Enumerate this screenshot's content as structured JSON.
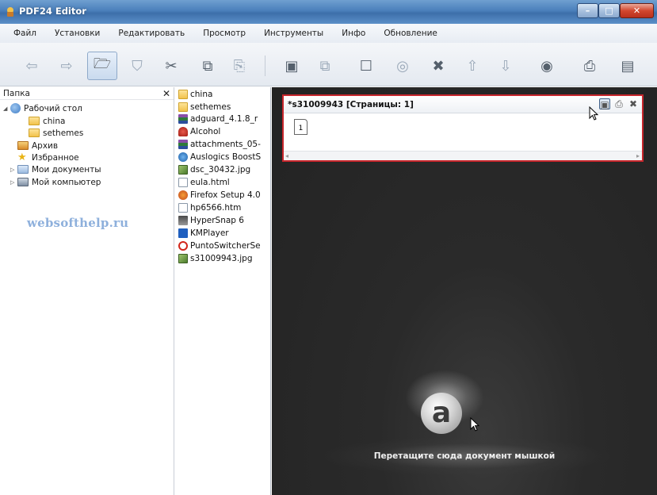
{
  "window": {
    "title": "PDF24 Editor",
    "minimize": "–",
    "maximize": "□",
    "close": "✕"
  },
  "menu": [
    "Файл",
    "Установки",
    "Редактировать",
    "Просмотр",
    "Инструменты",
    "Инфо",
    "Обновление"
  ],
  "toolbar": {
    "buttons": [
      {
        "name": "back-arrow-icon",
        "glyph": "⇦"
      },
      {
        "name": "forward-arrow-icon",
        "glyph": "⇨"
      },
      {
        "name": "open-folder-icon",
        "glyph": "🗁"
      },
      {
        "name": "shield-icon",
        "glyph": "⛉"
      },
      {
        "name": "scissors-icon",
        "glyph": "✂"
      },
      {
        "name": "copy-icon",
        "glyph": "⧉"
      },
      {
        "name": "paste-icon",
        "glyph": "⎘"
      },
      {
        "name": "save-icon",
        "glyph": "▣"
      },
      {
        "name": "save-all-icon",
        "glyph": "⧉"
      },
      {
        "name": "square-icon",
        "glyph": "☐"
      },
      {
        "name": "merge-icon",
        "glyph": "◎"
      },
      {
        "name": "delete-icon",
        "glyph": "✖"
      },
      {
        "name": "arrow-up-icon",
        "glyph": "⇧"
      },
      {
        "name": "arrow-down-icon",
        "glyph": "⇩"
      },
      {
        "name": "eye-icon",
        "glyph": "◉"
      },
      {
        "name": "printer-icon",
        "glyph": "⎙"
      },
      {
        "name": "document-icon",
        "glyph": "▤"
      }
    ]
  },
  "folder_panel": {
    "header": "Папка",
    "close": "✕",
    "tree": [
      {
        "label": "Рабочий стол",
        "icon": "desktop-icon"
      },
      {
        "label": "china",
        "icon": "folder-icon"
      },
      {
        "label": "sethemes",
        "icon": "folder-icon"
      },
      {
        "label": "Архив",
        "icon": "archive-icon"
      },
      {
        "label": "Избранное",
        "icon": "star-icon"
      },
      {
        "label": "Мои документы",
        "icon": "documents-icon"
      },
      {
        "label": "Мой компьютер",
        "icon": "computer-icon"
      }
    ],
    "watermark": "websofthelp.ru"
  },
  "files": [
    {
      "label": "china",
      "icon": "folder-icon"
    },
    {
      "label": "sethemes",
      "icon": "folder-icon"
    },
    {
      "label": "adguard_4.1.8_r",
      "icon": "archive-icon"
    },
    {
      "label": "Alcohol",
      "icon": "alcohol-icon"
    },
    {
      "label": "attachments_05-",
      "icon": "archive-icon"
    },
    {
      "label": "Auslogics BoostS",
      "icon": "auslogics-icon"
    },
    {
      "label": "dsc_30432.jpg",
      "icon": "image-icon"
    },
    {
      "label": "eula.html",
      "icon": "html-icon"
    },
    {
      "label": "Firefox Setup 4.0",
      "icon": "firefox-icon"
    },
    {
      "label": "hp6566.htm",
      "icon": "html-icon"
    },
    {
      "label": "HyperSnap 6",
      "icon": "hypersnap-icon"
    },
    {
      "label": "KMPlayer",
      "icon": "kmplayer-icon"
    },
    {
      "label": "PuntoSwitcherSe",
      "icon": "punto-icon"
    },
    {
      "label": "s31009943.jpg",
      "icon": "image-icon"
    }
  ],
  "document": {
    "title": "*s31009943 [Страницы: 1]",
    "page_number": "1",
    "save_icon": "▣",
    "print_icon": "⎙",
    "close_icon": "✖",
    "scroll_left": "◂",
    "scroll_right": "▸"
  },
  "dropzone": {
    "logo_letter": "a",
    "text": "Перетащите сюда документ мышкой"
  },
  "colors": {
    "titlebar": "#4a7fbb",
    "doc_border": "#c8262c",
    "workspace": "#2a2a2a"
  }
}
